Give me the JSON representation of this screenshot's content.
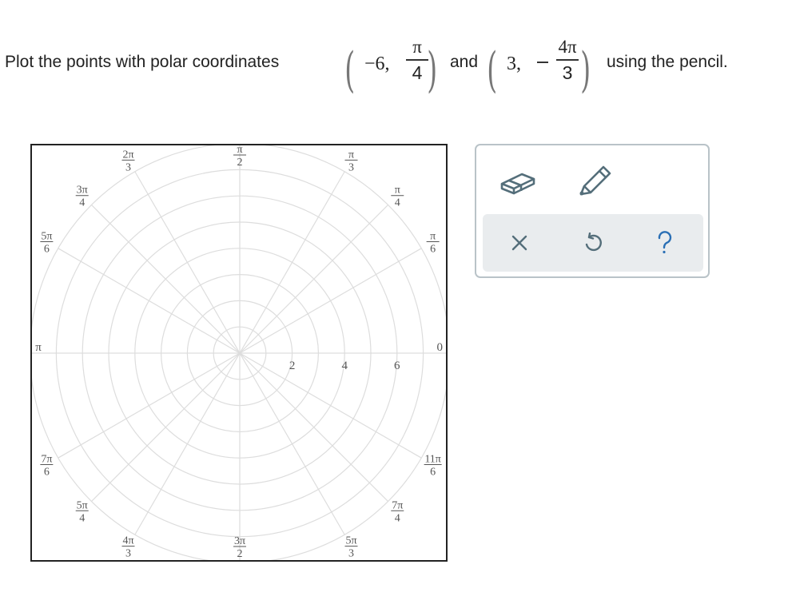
{
  "question": {
    "prefix": "Plot the points with polar coordinates",
    "point1": {
      "r": "−6,",
      "theta_num": "π",
      "theta_den": "4",
      "theta_sign": ""
    },
    "conjunction": "and",
    "point2": {
      "r": "3,",
      "theta_num": "4π",
      "theta_den": "3",
      "theta_sign": "−"
    },
    "suffix": "using the pencil."
  },
  "graph": {
    "type": "polar-grid",
    "r_max": 8,
    "r_step": 1,
    "radial_labels": [
      "2",
      "4",
      "6"
    ],
    "angle_labels": [
      {
        "num": "",
        "den": "",
        "text": "0",
        "deg": 0
      },
      {
        "num": "π",
        "den": "6",
        "deg": 30
      },
      {
        "num": "π",
        "den": "4",
        "deg": 45
      },
      {
        "num": "π",
        "den": "3",
        "deg": 60
      },
      {
        "num": "π",
        "den": "2",
        "deg": 90
      },
      {
        "num": "2π",
        "den": "3",
        "deg": 120
      },
      {
        "num": "3π",
        "den": "4",
        "deg": 135
      },
      {
        "num": "5π",
        "den": "6",
        "deg": 150
      },
      {
        "num": "",
        "den": "",
        "text": "π",
        "deg": 180
      },
      {
        "num": "7π",
        "den": "6",
        "deg": 210
      },
      {
        "num": "5π",
        "den": "4",
        "deg": 225
      },
      {
        "num": "4π",
        "den": "3",
        "deg": 240
      },
      {
        "num": "3π",
        "den": "2",
        "deg": 270
      },
      {
        "num": "5π",
        "den": "3",
        "deg": 300
      },
      {
        "num": "7π",
        "den": "4",
        "deg": 315
      },
      {
        "num": "11π",
        "den": "6",
        "deg": 330
      }
    ],
    "grid_color": "#dddddd",
    "label_color": "#555555"
  },
  "toolbar": {
    "tools": [
      {
        "name": "eraser-tool",
        "icon": "eraser-icon"
      },
      {
        "name": "pencil-tool",
        "icon": "pencil-icon"
      }
    ],
    "actions": [
      {
        "name": "clear-button",
        "icon": "close-icon"
      },
      {
        "name": "undo-button",
        "icon": "undo-icon"
      },
      {
        "name": "help-button",
        "icon": "question-icon"
      }
    ],
    "icon_color": "#546e7a",
    "accent_color": "#2a6fb5"
  }
}
